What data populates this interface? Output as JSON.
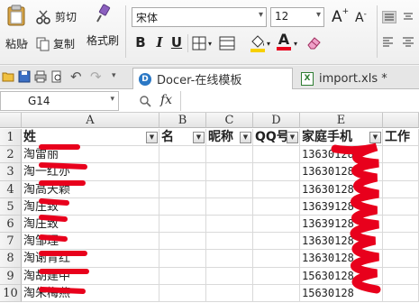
{
  "ribbon": {
    "cut_label": "剪切",
    "paste_label": "粘贴",
    "copy_label": "复制",
    "format_painter_label": "格式刷",
    "font_name": "宋体",
    "font_size": "12",
    "bold_label": "B",
    "italic_label": "I",
    "underline_label": "U",
    "grow_font_label": "A",
    "shrink_font_label": "A",
    "font_color_label": "A"
  },
  "tabs": [
    {
      "label": "Docer-在线模板"
    },
    {
      "label": "import.xls *"
    }
  ],
  "formula_bar": {
    "cell_ref": "G14",
    "fx_label": "fx",
    "value": ""
  },
  "columns": [
    "A",
    "B",
    "C",
    "D",
    "E"
  ],
  "rows": [
    "1",
    "2",
    "3",
    "4",
    "5",
    "6",
    "7",
    "8",
    "9",
    "10"
  ],
  "header_row": {
    "A": "姓",
    "B": "名",
    "C": "昵称",
    "D": "QQ号",
    "E": "家庭手机",
    "F": "工作"
  },
  "data_rows": [
    {
      "A": "淘雷丽",
      "E": "13630128"
    },
    {
      "A": "淘一红亦",
      "E": "13630128"
    },
    {
      "A": "淘高天颖",
      "E": "13630128"
    },
    {
      "A": "淘庄致",
      "E": "13639128"
    },
    {
      "A": "淘庄致",
      "E": "13639128"
    },
    {
      "A": "淘邹理",
      "E": "13630128"
    },
    {
      "A": "淘谢青红",
      "E": "13630128"
    },
    {
      "A": "淘胡建中",
      "E": "15630128"
    },
    {
      "A": "淘朱梅燕",
      "E": "15630128"
    }
  ],
  "colors": {
    "redaction": "#e8001c",
    "accent_blue": "#2b5797"
  }
}
